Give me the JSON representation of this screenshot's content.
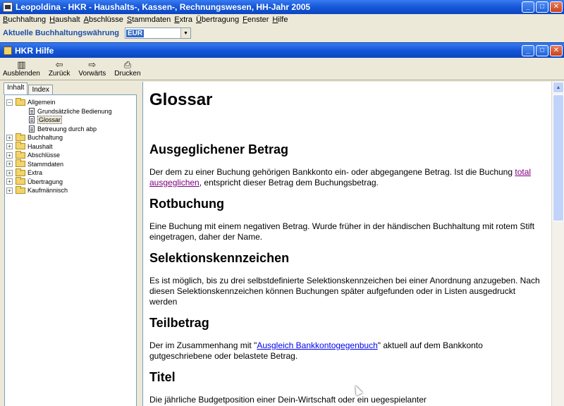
{
  "window": {
    "title": "Leopoldina - HKR - Haushalts-, Kassen-, Rechnungswesen, HH-Jahr 2005",
    "buttons": {
      "minimize": "_",
      "maximize": "□",
      "close": "✕"
    }
  },
  "menu": {
    "items": [
      "Buchhaltung",
      "Haushalt",
      "Abschlüsse",
      "Stammdaten",
      "Extra",
      "Übertragung",
      "Fenster",
      "Hilfe"
    ]
  },
  "currency": {
    "label": "Aktuelle Buchhaltungswährung",
    "value": "EUR"
  },
  "help": {
    "title": "HKR Hilfe",
    "buttons": {
      "minimize": "_",
      "maximize": "□",
      "close": "✕"
    },
    "toolbar": [
      {
        "label": "Ausblenden",
        "icon": "hide-icon",
        "glyph": "▥"
      },
      {
        "label": "Zurück",
        "icon": "back-arrow-icon",
        "glyph": "⇦"
      },
      {
        "label": "Vorwärts",
        "icon": "forward-arrow-icon",
        "glyph": "⇨"
      },
      {
        "label": "Drucken",
        "icon": "printer-icon",
        "glyph": "⎙"
      }
    ],
    "tabs": [
      "Inhalt",
      "Index"
    ],
    "tree": {
      "root": {
        "label": "Allgemein",
        "expander": "−"
      },
      "children": [
        "Grundsätzliche Bedienung",
        "Glossar",
        "Betreuung durch abp"
      ],
      "selected_child": "Glossar",
      "collapsed": [
        "Buchhaltung",
        "Haushalt",
        "Abschlüsse",
        "Stammdaten",
        "Extra",
        "Übertragung",
        "Kaufmännisch"
      ],
      "collapsed_expander": "+"
    },
    "content": {
      "title": "Glossar",
      "sections": [
        {
          "heading": "Ausgeglichener Betrag",
          "text_before": "Der dem zu einer Buchung gehörigen Bankkonto ein- oder abgegangene Betrag. Ist die Buchung ",
          "link": "total ausgeglichen",
          "text_after": ", entspricht dieser Betrag dem Buchungsbetrag."
        },
        {
          "heading": "Rotbuchung",
          "text": "Eine Buchung mit einem negativen Betrag. Wurde früher in der händischen Buchhaltung mit rotem Stift eingetragen, daher der Name."
        },
        {
          "heading": "Selektionskennzeichen",
          "text": "Es ist möglich, bis zu drei selbstdefinierte Selektionskennzeichen bei einer Anordnung anzugeben. Nach diesen Selektionskennzeichen können Buchungen später aufgefunden oder in Listen ausgedruckt werden"
        },
        {
          "heading": "Teilbetrag",
          "text_before": "Der im Zusammenhang mit \"",
          "link": "Ausgleich Bankkontogegenbuch",
          "text_after": "\" aktuell auf dem Bankkonto gutgeschriebene oder belastete Betrag."
        },
        {
          "heading": "Titel",
          "text": "Die jährliche Budgetposition einer Dein-Wirtschaft oder ein uegespielanter"
        }
      ]
    },
    "scrollbar": {
      "up": "▲",
      "down": "▼"
    }
  }
}
